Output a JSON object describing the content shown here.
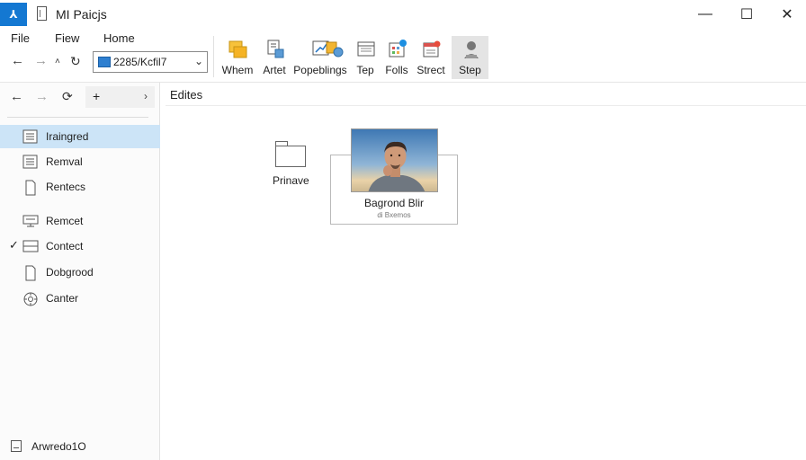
{
  "window": {
    "app_icon_glyph": "⅄",
    "title": "MI Paicjs",
    "controls": {
      "minimize": "—",
      "maximize": "☐",
      "close": "✕"
    }
  },
  "menubar": {
    "items": [
      "File",
      "Fiew",
      "Home"
    ]
  },
  "toolbar": {
    "back_icon": "arrow-left-icon",
    "forward_icon": "arrow-right-icon",
    "up_icon": "caret-up-icon",
    "refresh_icon": "refresh-icon",
    "address_value": "2285/Kcfil7",
    "address_caret": "⌄"
  },
  "ribbon": {
    "buttons": [
      {
        "label": "Whem",
        "icon": "folders-icon"
      },
      {
        "label": "Artet",
        "icon": "document-icon"
      },
      {
        "label": "Popeblings",
        "icon": "chart-icon"
      },
      {
        "label": "Tep",
        "icon": "properties-icon"
      },
      {
        "label": "Folls",
        "icon": "grid-icon"
      },
      {
        "label": "Strect",
        "icon": "calendar-icon"
      },
      {
        "label": "Step",
        "icon": "person-icon",
        "active": true
      }
    ]
  },
  "sidebar": {
    "nav": {
      "back": "←",
      "forward": "→",
      "pin": "⟳",
      "box_plus": "+",
      "box_caret": "›"
    },
    "items": [
      {
        "label": "Iraingred",
        "icon": "list-document-icon",
        "selected": true
      },
      {
        "label": "Remval",
        "icon": "list-document-icon"
      },
      {
        "label": "Rentecs",
        "icon": "blank-document-icon"
      },
      {
        "label": "Remcet",
        "icon": "monitor-icon"
      },
      {
        "label": "Contect",
        "icon": "panel-icon",
        "checked": true
      },
      {
        "label": "Dobgrood",
        "icon": "blank-document-icon"
      },
      {
        "label": "Canter",
        "icon": "gear-icon"
      }
    ],
    "checkmark": "✓",
    "footer": "Arwredo1O"
  },
  "content": {
    "breadcrumb": "Edites",
    "folder": {
      "label": "Prinave"
    },
    "photo": {
      "title": "Bagrond Blir",
      "subtitle": "di Bxemos"
    }
  },
  "colors": {
    "accent": "#1478d2",
    "selection": "#cce4f7",
    "ribbon_active": "#e4e4e4"
  }
}
